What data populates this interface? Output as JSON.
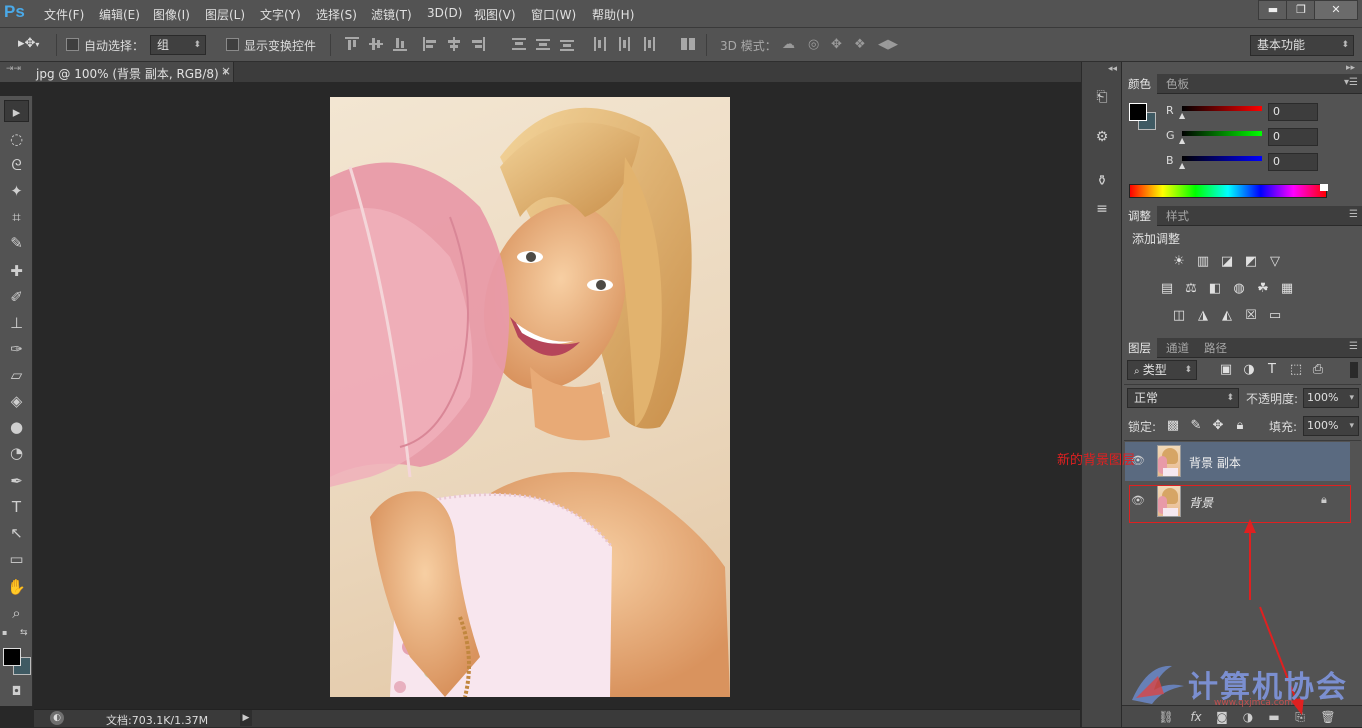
{
  "app": {
    "logo": "Ps"
  },
  "menu": [
    "文件(F)",
    "编辑(E)",
    "图像(I)",
    "图层(L)",
    "文字(Y)",
    "选择(S)",
    "滤镜(T)",
    "3D(D)",
    "视图(V)",
    "窗口(W)",
    "帮助(H)"
  ],
  "window_controls": {
    "minimize": "▬",
    "restore": "❐",
    "close": "✕"
  },
  "options": {
    "auto_select_label": "自动选择：",
    "auto_select_value": "组",
    "show_transform_label": "显示变换控件",
    "mode3d_label": "3D 模式：",
    "workspace": "基本功能"
  },
  "document": {
    "tab_title": "jpg @ 100% (背景 副本, RGB/8) *",
    "tab_close": "×",
    "status": "文档:703.1K/1.37M"
  },
  "color_panel": {
    "tabs": [
      "颜色",
      "色板"
    ],
    "channels": [
      {
        "label": "R",
        "value": "0"
      },
      {
        "label": "G",
        "value": "0"
      },
      {
        "label": "B",
        "value": "0"
      }
    ]
  },
  "adjust_panel": {
    "tabs": [
      "调整",
      "样式"
    ],
    "title": "添加调整"
  },
  "layers_panel": {
    "tabs": [
      "图层",
      "通道",
      "路径"
    ],
    "filter_type": "类型",
    "blend_mode": "正常",
    "opacity_label": "不透明度:",
    "opacity_value": "100%",
    "lock_label": "锁定:",
    "fill_label": "填充:",
    "fill_value": "100%",
    "layers": [
      {
        "name": "背景 副本",
        "selected": true
      },
      {
        "name": "背景",
        "selected": false,
        "locked": true
      }
    ]
  },
  "annotation": {
    "text": "新的背景图层"
  },
  "watermark": {
    "text": "计算机协会",
    "url": "www.qxjmca.com"
  },
  "colors": {
    "accent_red": "#e02020",
    "selected_layer": "#5a6a80",
    "ps_blue": "#4aa9e8"
  }
}
